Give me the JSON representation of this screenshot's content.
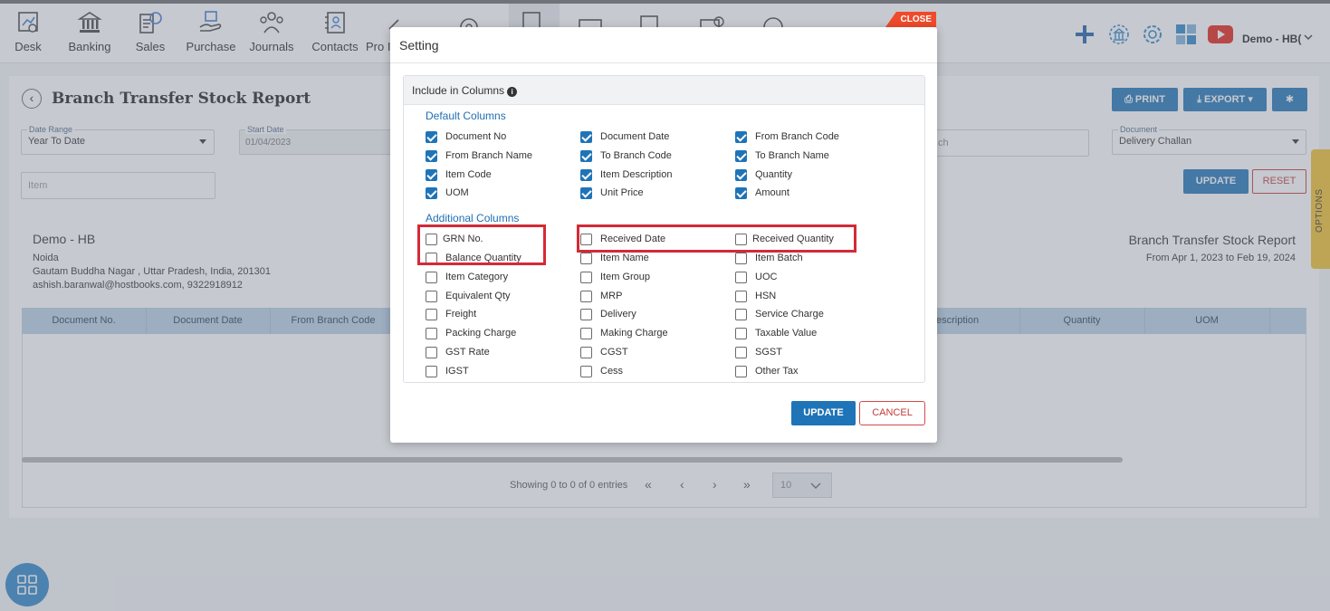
{
  "nav": {
    "items": [
      {
        "label": "Desk",
        "icon": "desk-icon"
      },
      {
        "label": "Banking",
        "icon": "bank-icon"
      },
      {
        "label": "Sales",
        "icon": "sales-icon"
      },
      {
        "label": "Purchase",
        "icon": "purchase-icon"
      },
      {
        "label": "Journals",
        "icon": "journals-icon"
      },
      {
        "label": "Contacts",
        "icon": "contacts-icon"
      },
      {
        "label": "Pro I",
        "icon": "product-icon"
      }
    ],
    "user": "Demo - HB(",
    "close_label": "CLOSE"
  },
  "report": {
    "title": "Branch Transfer Stock Report",
    "date_range_label": "Date Range",
    "date_range_value": "Year To Date",
    "start_date_label": "Start Date",
    "start_date_value": "01/04/2023",
    "search_partial": "ch",
    "document_label": "Document",
    "document_value": "Delivery Challan",
    "item_placeholder": "Item",
    "print_label": "PRINT",
    "export_label": "EXPORT",
    "update_label": "UPDATE",
    "reset_label": "RESET",
    "company_name": "Demo - HB",
    "city": "Noida",
    "address": "Gautam Buddha Nagar , Uttar Pradesh, India, 201301",
    "contact": "ashish.baranwal@hostbooks.com, 9322918912",
    "report_name": "Branch Transfer Stock Report",
    "period": "From Apr 1, 2023 to Feb 19, 2024",
    "columns": [
      "Document No.",
      "Document Date",
      "From Branch Code",
      "escription",
      "Quantity",
      "UOM"
    ],
    "pager_text": "Showing 0 to 0 of 0 entries",
    "page_size": "10",
    "options_label": "OPTIONS"
  },
  "modal": {
    "title": "Setting",
    "section_title": "Include in Columns",
    "default_title": "Default Columns",
    "additional_title": "Additional Columns",
    "default_columns": [
      {
        "label": "Document No",
        "checked": true
      },
      {
        "label": "Document Date",
        "checked": true
      },
      {
        "label": "From Branch Code",
        "checked": true
      },
      {
        "label": "From Branch Name",
        "checked": true
      },
      {
        "label": "To Branch Code",
        "checked": true
      },
      {
        "label": "To Branch Name",
        "checked": true
      },
      {
        "label": "Item Code",
        "checked": true
      },
      {
        "label": "Item Description",
        "checked": true
      },
      {
        "label": "Quantity",
        "checked": true
      },
      {
        "label": "UOM",
        "checked": true
      },
      {
        "label": "Unit Price",
        "checked": true
      },
      {
        "label": "Amount",
        "checked": true
      }
    ],
    "additional_columns": [
      {
        "label": "GRN No.",
        "checked": false
      },
      {
        "label": "Received Date",
        "checked": false
      },
      {
        "label": "Received Quantity",
        "checked": false
      },
      {
        "label": "Balance Quantity",
        "checked": false
      },
      {
        "label": "Item Name",
        "checked": false
      },
      {
        "label": "Item Batch",
        "checked": false
      },
      {
        "label": "Item Category",
        "checked": false
      },
      {
        "label": "Item Group",
        "checked": false
      },
      {
        "label": "UOC",
        "checked": false
      },
      {
        "label": "Equivalent Qty",
        "checked": false
      },
      {
        "label": "MRP",
        "checked": false
      },
      {
        "label": "HSN",
        "checked": false
      },
      {
        "label": "Freight",
        "checked": false
      },
      {
        "label": "Delivery",
        "checked": false
      },
      {
        "label": "Service Charge",
        "checked": false
      },
      {
        "label": "Packing Charge",
        "checked": false
      },
      {
        "label": "Making Charge",
        "checked": false
      },
      {
        "label": "Taxable Value",
        "checked": false
      },
      {
        "label": "GST Rate",
        "checked": false
      },
      {
        "label": "CGST",
        "checked": false
      },
      {
        "label": "SGST",
        "checked": false
      },
      {
        "label": "IGST",
        "checked": false
      },
      {
        "label": "Cess",
        "checked": false
      },
      {
        "label": "Other Tax",
        "checked": false
      }
    ],
    "update_label": "UPDATE",
    "cancel_label": "CANCEL"
  },
  "colors": {
    "accent": "#1f74b7",
    "highlight": "#d42a36",
    "close": "#ef4a2b"
  }
}
